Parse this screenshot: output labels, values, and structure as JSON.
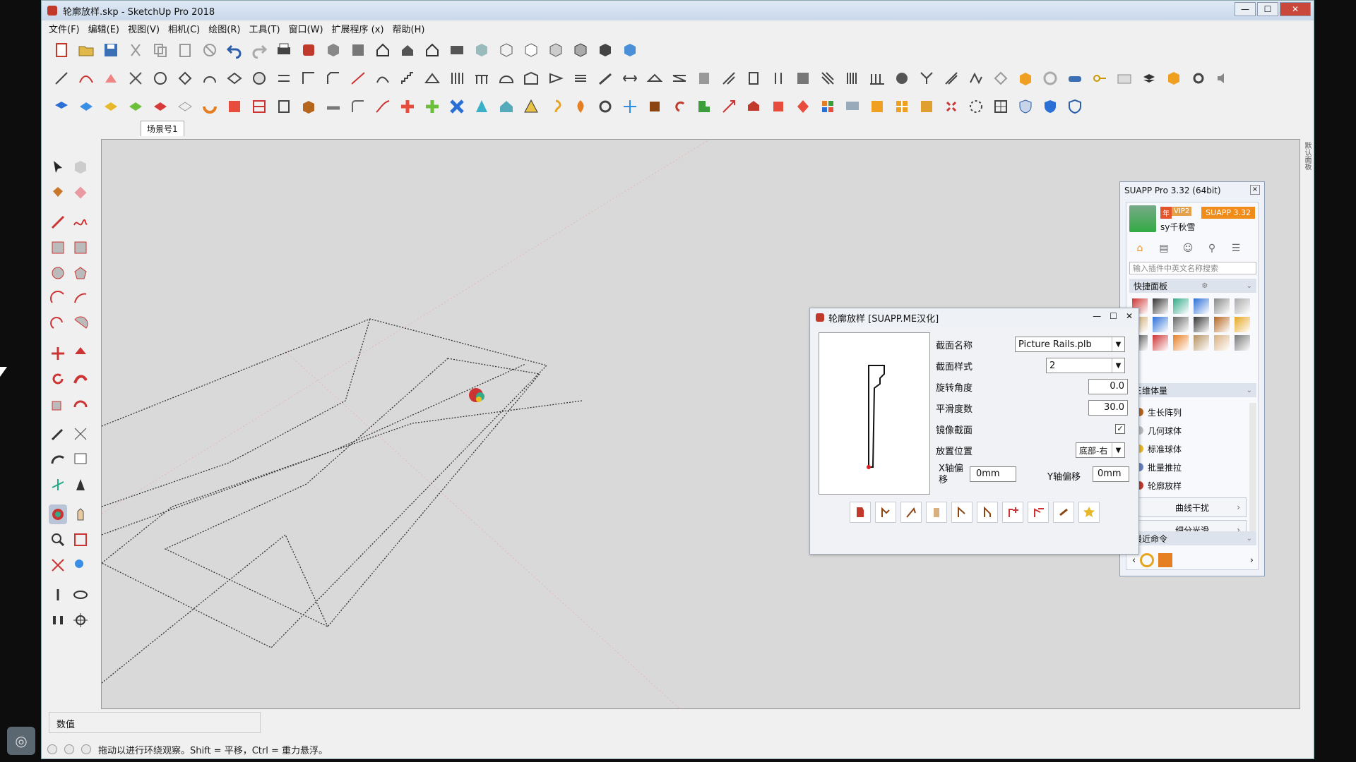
{
  "window": {
    "title": "轮廓放样.skp - SketchUp Pro 2018",
    "controls": [
      "—",
      "☐",
      "✕"
    ]
  },
  "menu": [
    "文件(F)",
    "编辑(E)",
    "视图(V)",
    "相机(C)",
    "绘图(R)",
    "工具(T)",
    "窗口(W)",
    "扩展程序 (x)",
    "帮助(H)"
  ],
  "scene_tab": "场景号1",
  "suapp": {
    "title": "SUAPP Pro 3.32 (64bit)",
    "close": "×",
    "badge_year": "年",
    "badge_vip": "VIP2",
    "badge_version": "SUAPP 3.32",
    "username": "sy千秋雪",
    "search_placeholder": "输入插件中英文名称搜索",
    "quick_panel": "快捷面板",
    "section_3d": "三维体量",
    "items": [
      "生长阵列",
      "几何球体",
      "标准球体",
      "批量推拉",
      "轮廓放样"
    ],
    "btn_curve": "曲线干扰",
    "btn_smooth": "细分光滑",
    "recent": "最近命令",
    "chev_down": "⌄",
    "arrow_right": "›",
    "arrow_left": "‹"
  },
  "dialog": {
    "title": "轮廓放样 [SUAPP.ME汉化]",
    "controls": [
      "—",
      "☐",
      "✕"
    ],
    "labels": {
      "section_name": "截面名称",
      "section_style": "截面样式",
      "rotation": "旋转角度",
      "smoothness": "平滑度数",
      "mirror": "镜像截面",
      "placement": "放置位置",
      "x_offset": "X轴偏移",
      "y_offset": "Y轴偏移"
    },
    "values": {
      "section_name": "Picture Rails.plb",
      "section_style": "2",
      "rotation": "0.0",
      "smoothness": "30.0",
      "mirror_checked": "✓",
      "placement": "底部-右",
      "x_offset": "0mm",
      "y_offset": "0mm"
    }
  },
  "status": {
    "value_label": "数值",
    "hint": "拖动以进行环绕观察。Shift = 平移，Ctrl = 重力悬浮。"
  },
  "right_dock": "默认面板"
}
